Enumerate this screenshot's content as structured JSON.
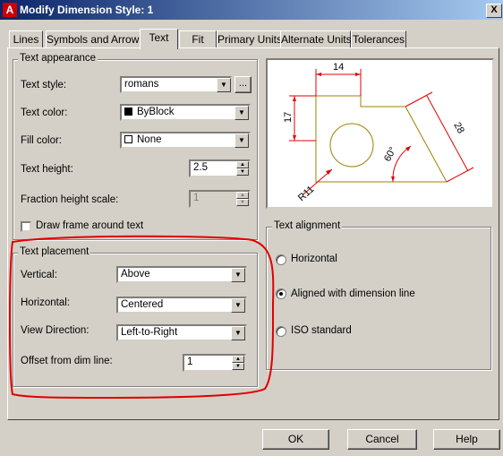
{
  "window": {
    "title": "Modify Dimension Style: 1",
    "app_icon": "A",
    "close_glyph": "X"
  },
  "tabs": [
    {
      "label": "Lines",
      "active": false
    },
    {
      "label": "Symbols and Arrows",
      "active": false
    },
    {
      "label": "Text",
      "active": true
    },
    {
      "label": "Fit",
      "active": false
    },
    {
      "label": "Primary Units",
      "active": false
    },
    {
      "label": "Alternate Units",
      "active": false
    },
    {
      "label": "Tolerances",
      "active": false
    }
  ],
  "text_appearance": {
    "title": "Text appearance",
    "text_style": {
      "label": "Text style:",
      "value": "romans",
      "browse_label": "..."
    },
    "text_color": {
      "label": "Text color:",
      "value": "ByBlock",
      "swatch": "#000000"
    },
    "fill_color": {
      "label": "Fill color:",
      "value": "None",
      "swatch": "#ffffff"
    },
    "text_height": {
      "label": "Text height:",
      "value": "2.5"
    },
    "fraction_height_scale": {
      "label": "Fraction height scale:",
      "value": "1",
      "enabled": false
    },
    "draw_frame": {
      "label": "Draw frame around text",
      "checked": false
    }
  },
  "text_placement": {
    "title": "Text placement",
    "vertical": {
      "label": "Vertical:",
      "value": "Above"
    },
    "horizontal": {
      "label": "Horizontal:",
      "value": "Centered"
    },
    "view_direction": {
      "label": "View Direction:",
      "value": "Left-to-Right"
    },
    "offset": {
      "label": "Offset from dim line:",
      "value": "1"
    }
  },
  "preview": {
    "dims": {
      "top": "14",
      "left": "17",
      "diag": "28",
      "angle": "60°",
      "radius": "R11"
    },
    "line_color": "#a08000",
    "dim_color": "#e00000"
  },
  "text_alignment": {
    "title": "Text alignment",
    "options": [
      {
        "label": "Horizontal",
        "selected": false
      },
      {
        "label": "Aligned with dimension line",
        "selected": true
      },
      {
        "label": "ISO standard",
        "selected": false
      }
    ]
  },
  "buttons": {
    "ok": "OK",
    "cancel": "Cancel",
    "help": "Help"
  },
  "annotation": {
    "color": "#e00000"
  }
}
